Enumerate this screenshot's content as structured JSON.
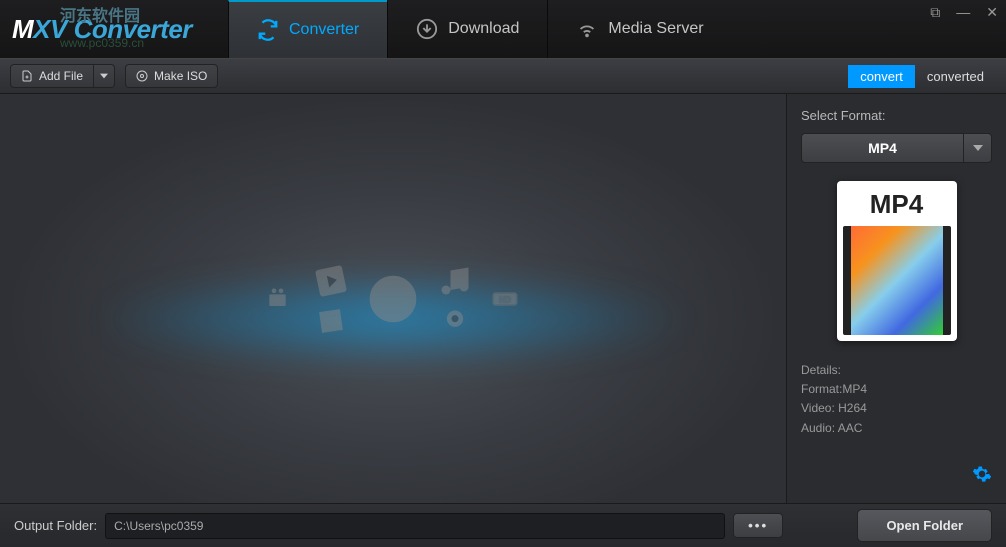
{
  "app": {
    "name": "MXV Converter",
    "watermark_top": "河东软件园",
    "watermark_bottom": "www.pc0359.cn"
  },
  "tabs": {
    "converter": "Converter",
    "download": "Download",
    "media_server": "Media Server"
  },
  "toolbar": {
    "add_file": "Add File",
    "make_iso": "Make ISO",
    "convert": "convert",
    "converted": "converted"
  },
  "sidebar": {
    "select_format_label": "Select Format:",
    "format": "MP4",
    "preview_label": "MP4",
    "details_title": "Details:",
    "detail_format": "Format:MP4",
    "detail_video": "Video: H264",
    "detail_audio": "Audio: AAC"
  },
  "footer": {
    "output_label": "Output Folder:",
    "output_path": "C:\\Users\\pc0359",
    "open_folder": "Open Folder"
  }
}
